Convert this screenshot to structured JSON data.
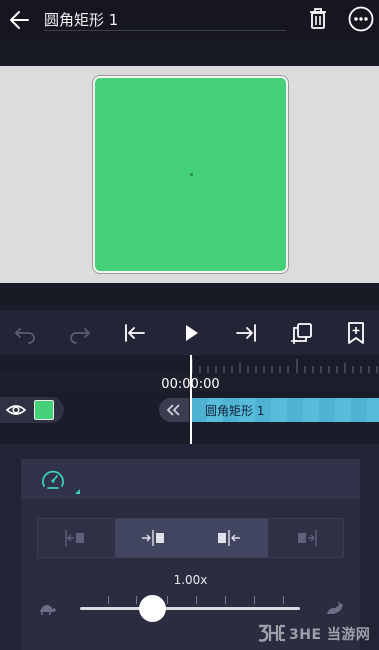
{
  "header": {
    "title": "圆角矩形 1",
    "back_icon": "arrow-left-icon",
    "delete_icon": "trash-icon",
    "more_icon": "more-horizontal-icon"
  },
  "canvas": {
    "shape_color": "#45d178",
    "background": "#dcdcdc"
  },
  "toolbar": {
    "items": [
      "undo-icon",
      "redo-icon",
      "jump-to-start-icon",
      "play-icon",
      "jump-to-end-icon",
      "duplicate-icon",
      "add-keyframe-icon"
    ]
  },
  "timeline": {
    "current_time": "00:00:00",
    "layer_color": "#45d178",
    "clip_label": "圆角矩形 1",
    "clip_color": "#4eb3d3"
  },
  "speed_panel": {
    "icon": "speedometer-icon",
    "accent": "#3ed1b4",
    "options": [
      "align-start-icon",
      "trim-right-icon",
      "trim-left-icon",
      "align-end-icon"
    ],
    "active_options": [
      1,
      2
    ],
    "speed_label": "1.00x",
    "speed_fraction": 0.33,
    "slow_icon": "turtle-icon",
    "fast_icon": "rabbit-icon"
  },
  "watermark": {
    "text": "3HE 当游网"
  }
}
